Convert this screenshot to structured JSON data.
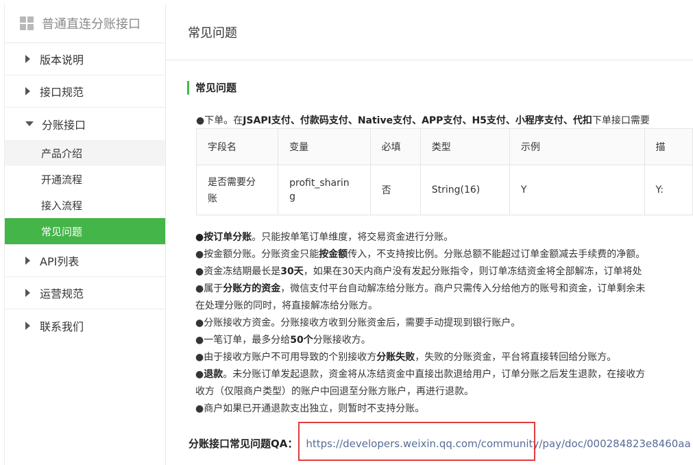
{
  "sidebar": {
    "title": "普通直连分账接口",
    "items": [
      {
        "label": "版本说明"
      },
      {
        "label": "接口规范"
      },
      {
        "label": "分账接口",
        "expanded": true,
        "children": [
          {
            "label": "产品介绍"
          },
          {
            "label": "开通流程"
          },
          {
            "label": "接入流程"
          },
          {
            "label": "常见问题",
            "active": true
          }
        ]
      },
      {
        "label": "API列表"
      },
      {
        "label": "运营规范"
      },
      {
        "label": "联系我们"
      }
    ]
  },
  "main": {
    "page_title": "常见问题",
    "section_title": "常见问题",
    "order_line": {
      "prefix": "●下单。在",
      "bold": "JSAPI支付、付款码支付、Native支付、APP支付、H5支付、小程序支付、代扣",
      "suffix": "下单接口需要"
    },
    "table": {
      "headers": [
        "字段名",
        "变量",
        "必填",
        "类型",
        "示例",
        "描"
      ],
      "rows": [
        [
          "是否需要分账",
          "profit_sharing",
          "否",
          "String(16)",
          "Y",
          "Y:"
        ]
      ],
      "row_display": {
        "c0_l1": "是否需要分",
        "c0_l2": "账",
        "c1_l1": "profit_sharin",
        "c1_l2": "g"
      }
    },
    "notes": {
      "n1_b": "●按订单分账",
      "n1_t": "。只能按单笔订单维度，将交易资金进行分账。",
      "n2_a": "●按金额分账。分账资金只能",
      "n2_b": "按金额",
      "n2_c": "传入，不支持按比例。分账总额不能超过订单金额减去手续费的净额。",
      "n3_a": "●资金冻结期最长是",
      "n3_b": "30天",
      "n3_c": "，如果在30天内商户没有发起分账指令，则订单冻结资金将全部解冻，订单将处",
      "n4_a": "●属于",
      "n4_b": "分账方的资金",
      "n4_c": "，微信支付平台自动解冻给分账方。商户只需传入分给他方的账号和资金，订单剩余未",
      "n4_d": "在处理分账的同时，将直接解冻给分账方。",
      "n5": "●分账接收方资金。分账接收方收到分账资金后，需要手动提现到银行账户。",
      "n6_a": "●一笔订单，最多分给",
      "n6_b": "50个",
      "n6_c": "分账接收方。",
      "n7_a": "●由于接收方账户不可用导致的个别接收方",
      "n7_b": "分账失败",
      "n7_c": "，失败的分账资金，平台将直接转回给分账方。",
      "n8_a": "●",
      "n8_b": "退款",
      "n8_c": "。未分账订单发起退款，资金将从冻结资金中直接出款退给用户，订单分账之后发生退款，在接收方",
      "n8_d": "收方（仅限商户类型）的账户中回退至分账方账户，再进行退款。",
      "n9": "●商户如果已开通退款支出独立，则暂时不支持分账。"
    },
    "qa": {
      "label": "分账接口常见问题QA：",
      "link": "https://developers.weixin.qq.com/community/pay/doc/000284823e8460aa"
    }
  },
  "colors": {
    "accent": "#44b549",
    "link": "#576b95",
    "highlight": "#e03c3c"
  }
}
